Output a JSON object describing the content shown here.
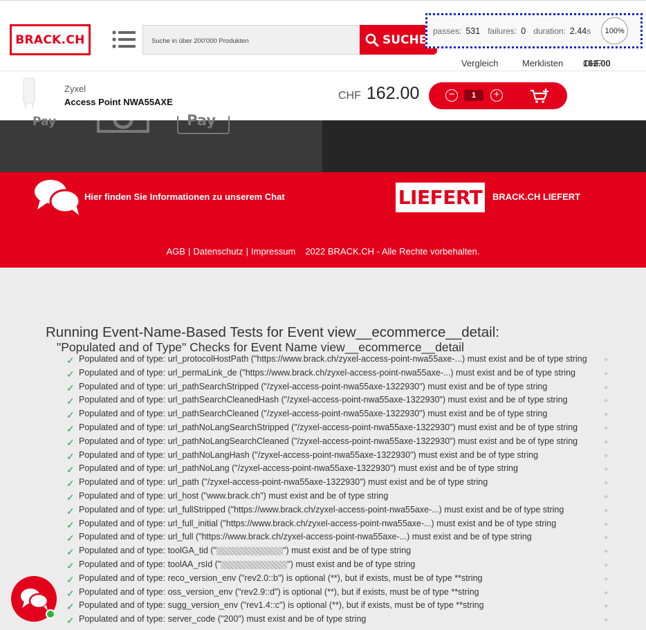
{
  "header": {
    "logo": "BRACK.CH",
    "search_placeholder": "Suche in über 200'000 Produkten",
    "search_button": "SUCHEN",
    "links": {
      "compare": "Vergleich",
      "wishlists": "Merklisten",
      "cart_currency": "CHF",
      "cart_total": "162.00"
    }
  },
  "test_overlay": {
    "passes_label": "passes:",
    "passes": "531",
    "failures_label": "failures:",
    "failures": "0",
    "duration_label": "duration:",
    "duration": "2.44",
    "duration_unit": "s",
    "progress": "100%"
  },
  "product": {
    "brand": "Zyxel",
    "name": "Access Point NWA55AXE",
    "currency": "CHF",
    "price": "162.00",
    "quantity": "1"
  },
  "payment_icons": [
    "Pay",
    "Pay"
  ],
  "footer": {
    "chat_text": "Hier finden Sie Informationen zu unserem Chat",
    "liefert_logo": "LIEFERT",
    "liefert_text": "BRACK.CH LIEFERT",
    "agb": "AGB",
    "privacy": "Datenschutz",
    "imprint": "Impressum",
    "separator": "|",
    "copyright": "2022 BRACK.CH - Alle Rechte vorbehalten."
  },
  "tests": {
    "title": "Running Event-Name-Based Tests for Event view__ecommerce__detail:",
    "subtitle": "\"Populated and of Type\" Checks for Event Name view__ecommerce__detail",
    "rows": [
      "Populated and of type: url_protocolHostPath (\"https://www.brack.ch/zyxel-access-point-nwa55axe-...) must exist and be of type string",
      "Populated and of type: url_permaLink_de (\"https://www.brack.ch/zyxel-access-point-nwa55axe-...) must exist and be of type string",
      "Populated and of type: url_pathSearchStripped (\"/zyxel-access-point-nwa55axe-1322930\") must exist and be of type string",
      "Populated and of type: url_pathSearchCleanedHash (\"/zyxel-access-point-nwa55axe-1322930\") must exist and be of type string",
      "Populated and of type: url_pathSearchCleaned (\"/zyxel-access-point-nwa55axe-1322930\") must exist and be of type string",
      "Populated and of type: url_pathNoLangSearchStripped (\"/zyxel-access-point-nwa55axe-1322930\") must exist and be of type string",
      "Populated and of type: url_pathNoLangSearchCleaned (\"/zyxel-access-point-nwa55axe-1322930\") must exist and be of type string",
      "Populated and of type: url_pathNoLangHash (\"/zyxel-access-point-nwa55axe-1322930\") must exist and be of type string",
      "Populated and of type: url_pathNoLang (\"/zyxel-access-point-nwa55axe-1322930\") must exist and be of type string",
      "Populated and of type: url_path (\"/zyxel-access-point-nwa55axe-1322930\") must exist and be of type string",
      "Populated and of type: url_host (\"www.brack.ch\") must exist and be of type string",
      "Populated and of type: url_fullStripped (\"https://www.brack.ch/zyxel-access-point-nwa55axe-...) must exist and be of type string",
      "Populated and of type: url_full_initial (\"https://www.brack.ch/zyxel-access-point-nwa55axe-...) must exist and be of type string",
      "Populated and of type: url_full (\"https://www.brack.ch/zyxel-access-point-nwa55axe-...) must exist and be of type string",
      "Populated and of type: reco_version_env (\"rev2.0::b\") is optional (**), but if exists, must be of type **string",
      "Populated and of type: oss_version_env (\"rev2.9::d\") is optional (**), but if exists, must be of type **string",
      "Populated and of type: sugg_version_env (\"rev1.4::c\") is optional (**), but if exists, must be of type **string",
      "Populated and of type: server_code (\"200\") must exist and be of type string"
    ],
    "blurred_rows": {
      "ga_prefix": "Populated and of type: toolGA_tid (\"",
      "ga_suffix": "\") must exist and be of type string",
      "aa_prefix": "Populated and of type: toolAA_rsId (\"",
      "aa_suffix": "\") must exist and be of type string"
    }
  }
}
